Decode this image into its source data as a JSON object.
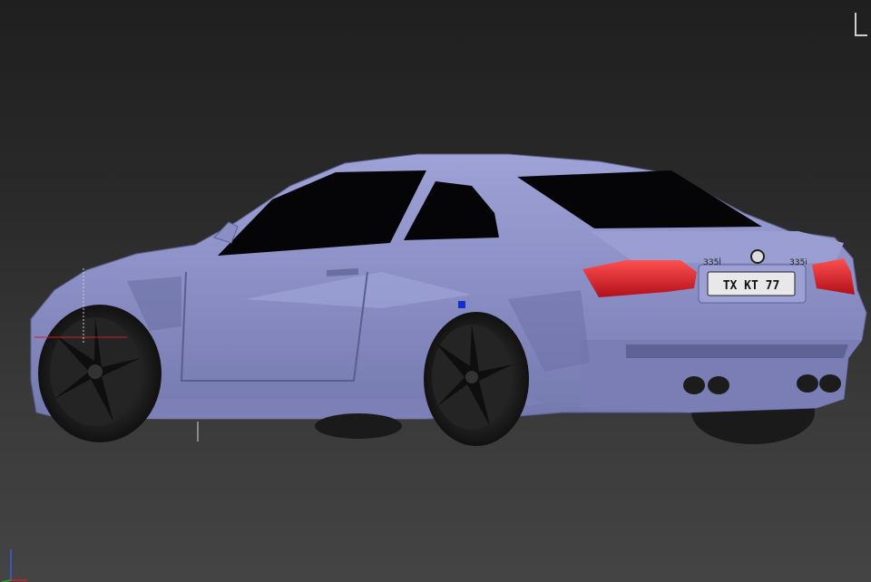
{
  "viewport": {
    "background_top": "#1f1f1f",
    "background_bottom": "#444444"
  },
  "car": {
    "body_color": "#8e92c8",
    "body_shadow": "#6c70a6",
    "glass_color": "#050508",
    "tail_light_color": "#e8202c",
    "wheel_color": "#1a1a1a",
    "trunk_badge_left": "ЗЗ5İ",
    "trunk_badge_right": "335i",
    "license_plate": "ТХ КТ 77"
  },
  "icons": {
    "viewcube": "viewcube-icon",
    "axis_tripod": "axis-tripod-icon"
  }
}
